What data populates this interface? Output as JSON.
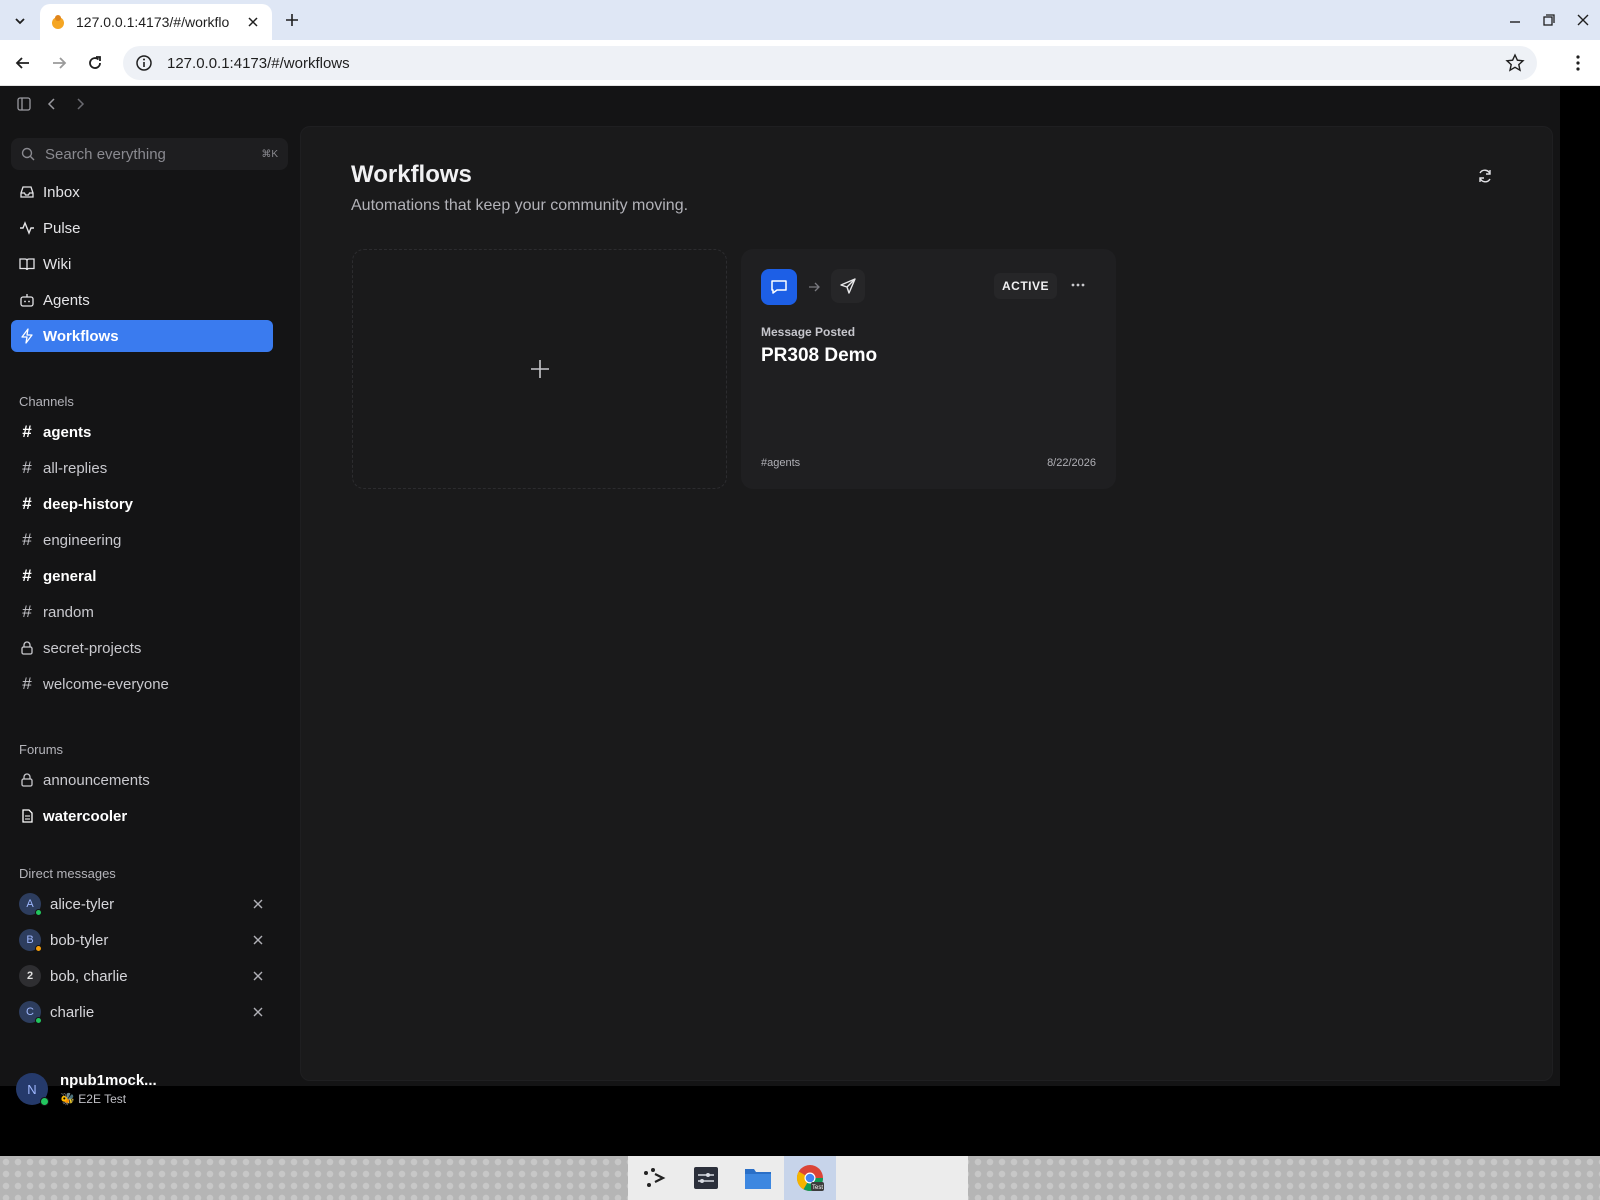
{
  "browser": {
    "tab_title": "127.0.0.1:4173/#/workflo",
    "url": "127.0.0.1:4173/#/workflows"
  },
  "sidebar": {
    "search_placeholder": "Search everything",
    "search_shortcut": "⌘K",
    "nav": [
      {
        "label": "Inbox",
        "icon": "inbox-icon"
      },
      {
        "label": "Pulse",
        "icon": "activity-icon"
      },
      {
        "label": "Wiki",
        "icon": "book-icon"
      },
      {
        "label": "Agents",
        "icon": "bot-icon"
      },
      {
        "label": "Workflows",
        "icon": "zap-icon",
        "active": true
      }
    ],
    "channels_label": "Channels",
    "channels": [
      {
        "name": "agents",
        "bold": true,
        "icon": "hash"
      },
      {
        "name": "all-replies",
        "bold": false,
        "icon": "hash"
      },
      {
        "name": "deep-history",
        "bold": true,
        "icon": "hash"
      },
      {
        "name": "engineering",
        "bold": false,
        "icon": "hash"
      },
      {
        "name": "general",
        "bold": true,
        "icon": "hash"
      },
      {
        "name": "random",
        "bold": false,
        "icon": "hash"
      },
      {
        "name": "secret-projects",
        "bold": false,
        "icon": "lock"
      },
      {
        "name": "welcome-everyone",
        "bold": false,
        "icon": "hash"
      }
    ],
    "forums_label": "Forums",
    "forums": [
      {
        "name": "announcements",
        "bold": false,
        "icon": "lock"
      },
      {
        "name": "watercooler",
        "bold": true,
        "icon": "doc"
      }
    ],
    "dms_label": "Direct messages",
    "dms": [
      {
        "name": "alice-tyler",
        "initial": "A",
        "presence": "#22c55e"
      },
      {
        "name": "bob-tyler",
        "initial": "B",
        "presence": "#f59e0b"
      },
      {
        "name": "bob, charlie",
        "initial": "2",
        "presence": ""
      },
      {
        "name": "charlie",
        "initial": "C",
        "presence": "#22c55e"
      }
    ],
    "user": {
      "initial": "N",
      "name": "npub1mock...",
      "status_emoji": "🐝",
      "status_text": "E2E Test"
    }
  },
  "main": {
    "title": "Workflows",
    "subtitle": "Automations that keep your community moving.",
    "workflow": {
      "status": "ACTIVE",
      "trigger": "Message Posted",
      "name": "PR308 Demo",
      "channel": "#agents",
      "date": "8/22/2026"
    }
  },
  "colors": {
    "accent": "#3a7bef",
    "trigger_bg": "#1d5fe6",
    "app_bg": "#141415",
    "panel_bg": "#1a1a1b"
  }
}
